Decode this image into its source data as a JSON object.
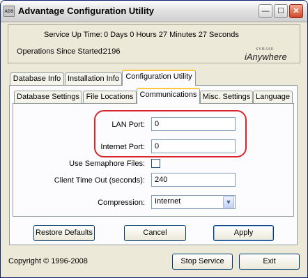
{
  "window": {
    "title": "Advantage Configuration Utility",
    "icon_text": "ADS",
    "buttons": {
      "minimize": "—",
      "maximize": "☐",
      "close": "✕"
    }
  },
  "service_info": {
    "uptime_label": "Service Up Time:",
    "uptime_value": "0 Days 0 Hours 27 Minutes 27 Seconds",
    "ops_label": "Operations Since Started:",
    "ops_value": "2196"
  },
  "brand": {
    "small": "SYBASE",
    "name": "iAnywhere"
  },
  "outer_tabs": [
    "Database Info",
    "Installation Info",
    "Configuration Utility"
  ],
  "inner_tabs": [
    "Database Settings",
    "File Locations",
    "Communications",
    "Misc. Settings",
    "Language"
  ],
  "communications": {
    "lan_port_label": "LAN Port:",
    "lan_port_value": "0",
    "internet_port_label": "Internet Port:",
    "internet_port_value": "0",
    "semaphore_label": "Use Semaphore Files:",
    "semaphore_checked": false,
    "timeout_label": "Client Time Out (seconds):",
    "timeout_value": "240",
    "compression_label": "Compression:",
    "compression_value": "Internet"
  },
  "buttons": {
    "restore": "Restore Defaults",
    "cancel": "Cancel",
    "apply": "Apply",
    "stop_service": "Stop Service",
    "exit": "Exit"
  },
  "footer": {
    "copyright": "Copyright © 1996-2008"
  },
  "colors": {
    "highlight_ring": "#d9252a",
    "tab_accent": "#ffc83c",
    "button_border": "#003c74"
  }
}
